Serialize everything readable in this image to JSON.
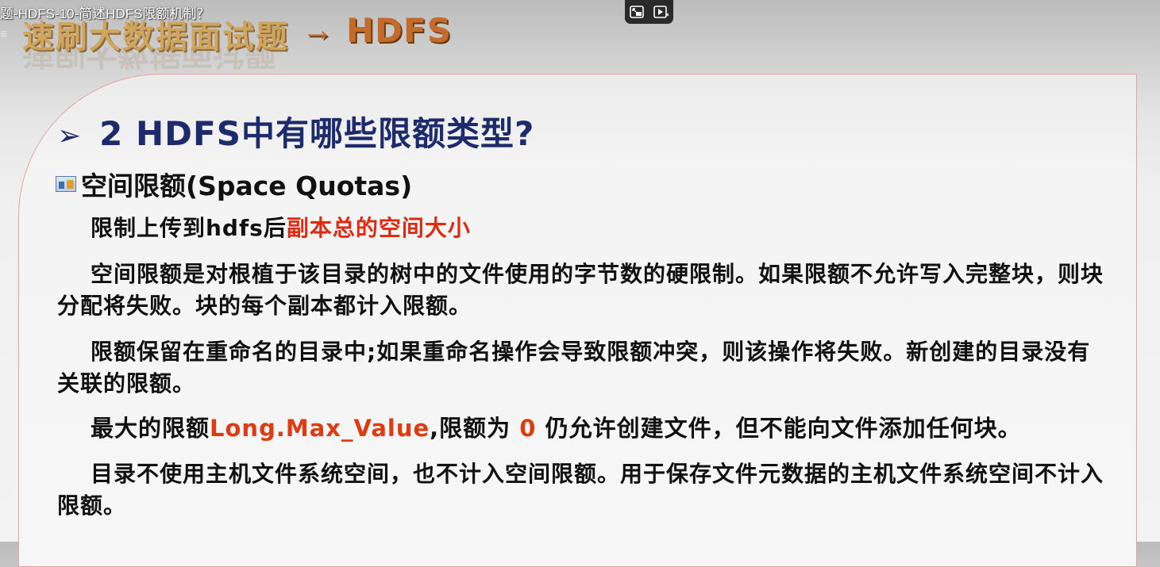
{
  "video": {
    "title": "题-HDFS-10-简述HDFS限额机制？"
  },
  "banner": {
    "left_text": "速刷大数据面试题",
    "arrow": "→",
    "right_text": "HDFS"
  },
  "player_controls": {
    "icons": [
      "miniplayer-icon",
      "play-next-icon"
    ]
  },
  "slide": {
    "heading": "2 HDFS中有哪些限额类型?",
    "subheading": "空间限额(Space Quotas)",
    "p1_prefix": "限制上传到hdfs后",
    "p1_highlight": "副本总的空间大小",
    "p2": "空间限额是对根植于该目录的树中的文件使用的字节数的硬限制。如果限额不允许写入完整块，则块分配将失败。块的每个副本都计入限额。",
    "p3": "限额保留在重命名的目录中;如果重命名操作会导致限额冲突，则该操作将失败。新创建的目录没有关联的限额。",
    "p4_prefix": "最大的限额",
    "p4_highlight": "Long.Max_Value",
    "p4_mid": ",限额为 ",
    "p4_zero": "0",
    "p4_suffix": " 仍允许创建文件，但不能向文件添加任何块。",
    "p5": "目录不使用主机文件系统空间，也不计入空间限额。用于保存文件元数据的主机文件系统空间不计入限额。"
  },
  "colors": {
    "heading": "#1d2b6c",
    "highlight": "#e02a10",
    "panel_border": "#e6a3a3"
  }
}
